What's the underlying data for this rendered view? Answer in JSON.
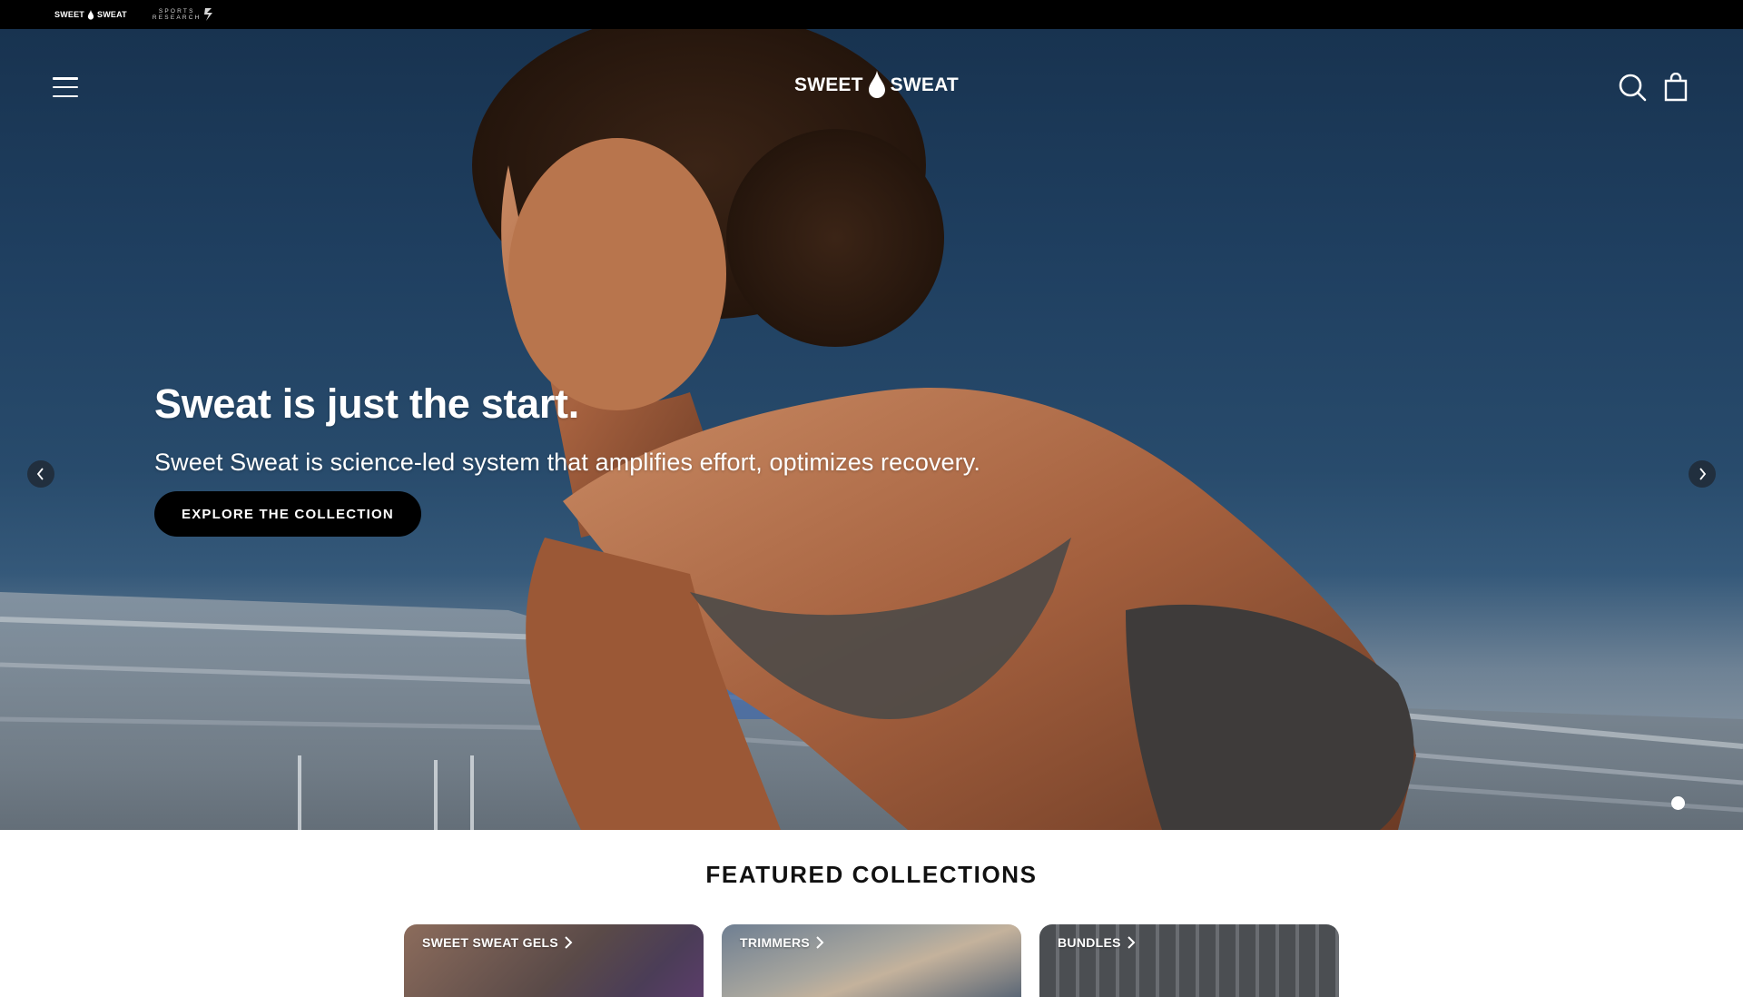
{
  "brandbar": {
    "brand_name_left": "SWEET",
    "brand_name_right": "SWEAT",
    "partner_line_1": "SPORTS",
    "partner_line_2": "RESEARCH"
  },
  "header": {
    "logo_left": "SWEET",
    "logo_right": "SWEAT",
    "icons": [
      "menu-icon",
      "search-icon",
      "cart-icon"
    ]
  },
  "hero": {
    "title": "Sweat is just the start.",
    "subtitle": "Sweet Sweat is science-led system that amplifies effort, optimizes recovery.",
    "cta_label": "EXPLORE THE COLLECTION",
    "slide_count": 1,
    "active_slide": 1
  },
  "featured": {
    "title": "FEATURED COLLECTIONS",
    "cards": [
      {
        "label": "SWEET SWEAT GELS"
      },
      {
        "label": "TRIMMERS"
      },
      {
        "label": "BUNDLES"
      }
    ]
  },
  "colors": {
    "topbar": "#000000",
    "cta_bg": "#000000",
    "text_light": "#ffffff",
    "heading_dark": "#111111"
  }
}
